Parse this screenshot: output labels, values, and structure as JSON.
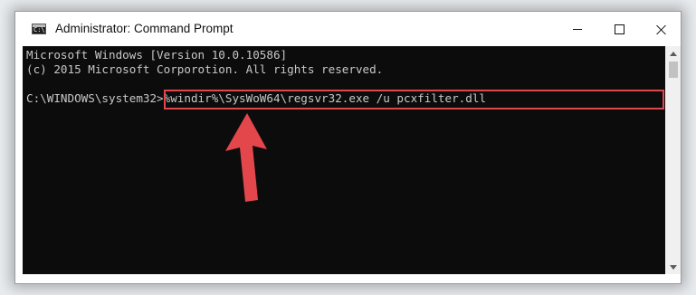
{
  "window": {
    "title": "Administrator: Command Prompt",
    "icon": "cmd-icon",
    "controls": {
      "minimize_icon": "minimize-icon",
      "maximize_icon": "maximize-icon",
      "close_icon": "close-icon"
    }
  },
  "console": {
    "lines": [
      "Microsoft Windows [Version 10.0.10586]",
      "(c) 2015 Microsoft Corporotion. All rights reserved.",
      "",
      "C:\\WINDOWS\\system32>%windir%\\SysWoW64\\regsvr32.exe /u pcxfilter.dll"
    ],
    "background_color": "#0c0c0c",
    "text_color": "#c8c8c8"
  },
  "annotation": {
    "highlight_color": "#e0474c",
    "arrow_icon": "red-arrow-up-icon"
  },
  "scrollbar": {
    "up_icon": "scroll-up-icon",
    "down_icon": "scroll-down-icon"
  }
}
